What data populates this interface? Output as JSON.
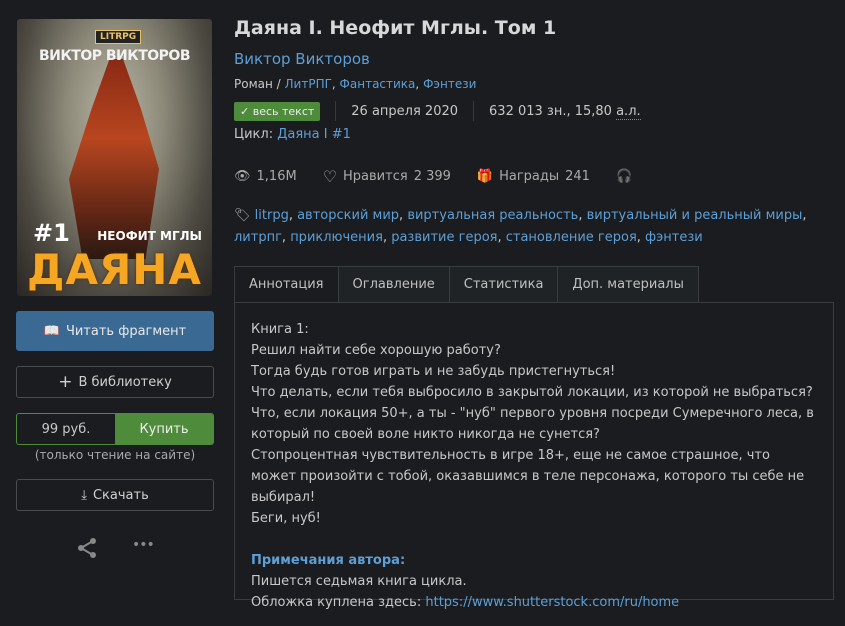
{
  "cover": {
    "badge": "LITRPG",
    "author": "ВИКТОР ВИКТОРОВ",
    "number": "#1",
    "subtitle": "НЕОФИТ МГЛЫ",
    "title": "ДАЯНА I"
  },
  "sidebar": {
    "read_label": "Читать фрагмент",
    "library_label": "В библиотеку",
    "price": "99 руб.",
    "buy_label": "Купить",
    "buy_note": "(только чтение на сайте)",
    "download_label": "Скачать",
    "more": "•••"
  },
  "book": {
    "title": "Даяна I. Неофит Мглы. Том 1",
    "author": "Виктор Викторов",
    "genre_prefix": "Роман / ",
    "genres": [
      "ЛитРПГ",
      "Фантастика",
      "Фэнтези"
    ],
    "status": "весь текст",
    "date": "26 апреля 2020",
    "size": "632 013 зн., 15,80 ",
    "size_unit": "а.л.",
    "cycle_label": "Цикл: ",
    "cycle": "Даяна I #1",
    "views": "1,16M",
    "likes_label": "Нравится",
    "likes": "2 399",
    "awards_label": "Награды",
    "awards": "241",
    "tags": [
      "litrpg",
      "авторский мир",
      "виртуальная реальность",
      "виртуальный и реальный миры",
      "литрпг",
      "приключения",
      "развитие героя",
      "становление героя",
      "фэнтези"
    ]
  },
  "tabs": [
    "Аннотация",
    "Оглавление",
    "Статистика",
    "Доп. материалы"
  ],
  "annotation": {
    "lines": [
      "Книга 1:",
      "Решил найти себе хорошую работу?",
      "Тогда будь готов играть и не забудь пристегнуться!",
      "Что делать, если тебя выбросило в закрытой локации, из которой не выбраться? Что, если локация 50+, а ты - \"нуб\" первого уровня посреди Сумеречного леса, в который по своей воле никто никогда не сунется?",
      "Стопроцентная чувствительность в игре 18+, еще не самое страшное, что может произойти с тобой, оказавшимся в теле персонажа, которого ты себе не выбирал!",
      "Беги, нуб!"
    ],
    "notes_title": "Примечания автора:",
    "notes": "Пишется седьмая книга цикла.",
    "cover_label": "Обложка куплена здесь: ",
    "cover_link": "https://www.shutterstock.com/ru/home"
  }
}
